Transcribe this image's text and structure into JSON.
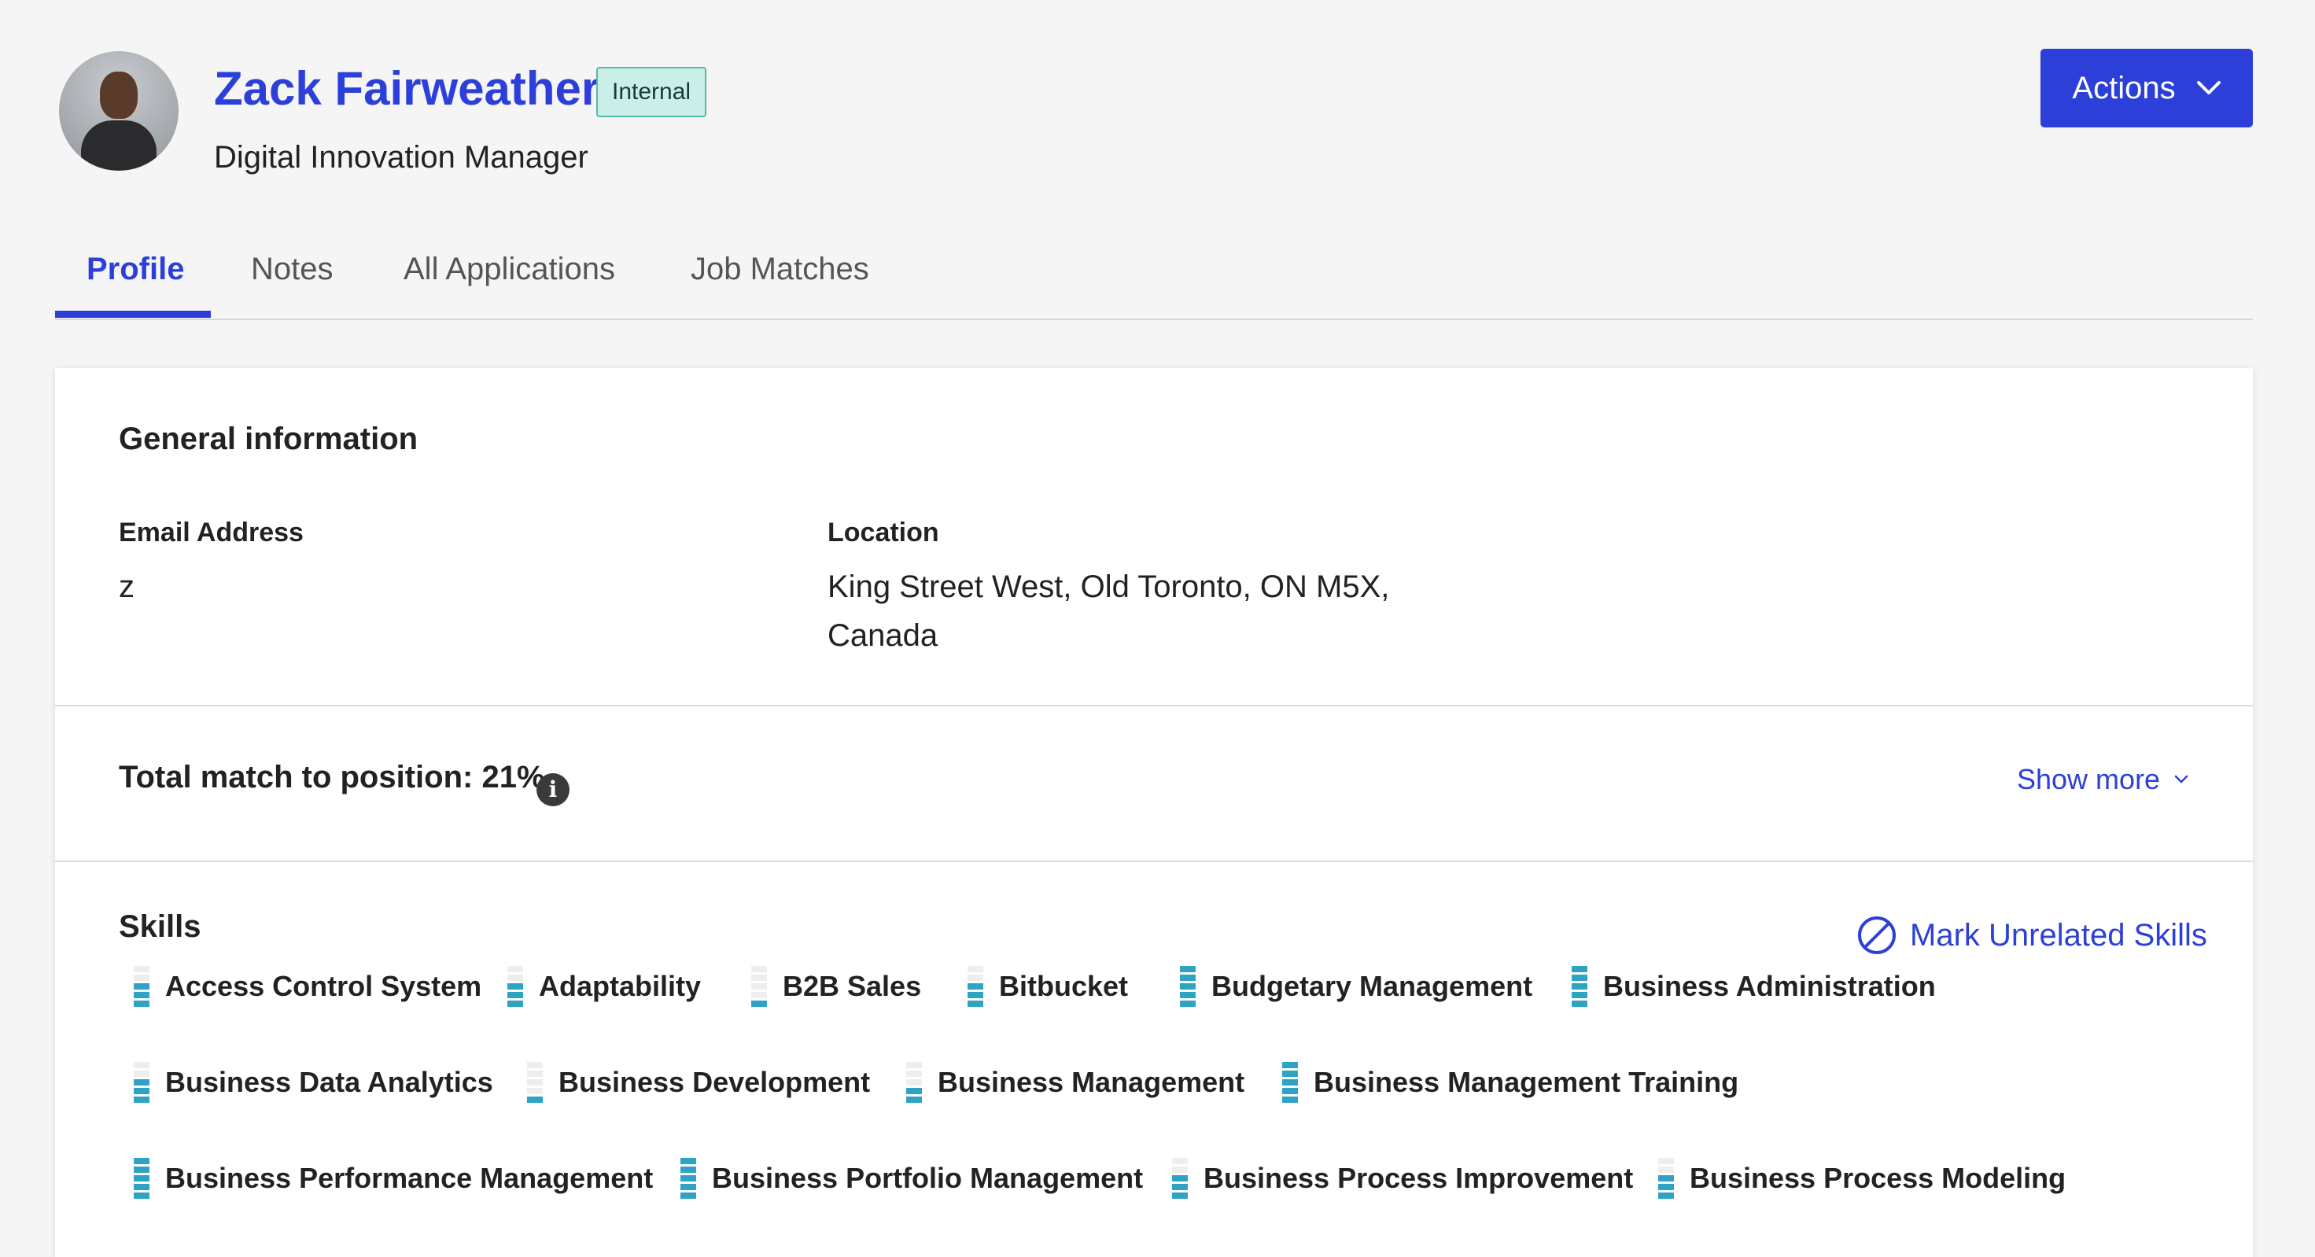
{
  "header": {
    "name": "Zack Fairweather",
    "badge": "Internal",
    "title": "Digital Innovation Manager",
    "actions_label": "Actions"
  },
  "tabs": [
    {
      "label": "Profile",
      "active": true
    },
    {
      "label": "Notes",
      "active": false
    },
    {
      "label": "All Applications",
      "active": false
    },
    {
      "label": "Job Matches",
      "active": false
    }
  ],
  "general": {
    "heading": "General information",
    "email_label": "Email Address",
    "email_value": "z",
    "location_label": "Location",
    "location_line1": "King Street West, Old Toronto, ON M5X,",
    "location_line2": "Canada"
  },
  "match": {
    "label": "Total match to position: 21%",
    "show_more": "Show more"
  },
  "skills": {
    "heading": "Skills",
    "mark_unrelated": "Mark Unrelated Skills",
    "level_max": 5,
    "items": [
      {
        "name": "Access Control System",
        "level": 3
      },
      {
        "name": "Adaptability",
        "level": 3
      },
      {
        "name": "B2B Sales",
        "level": 1
      },
      {
        "name": "Bitbucket",
        "level": 3
      },
      {
        "name": "Budgetary Management",
        "level": 5
      },
      {
        "name": "Business Administration",
        "level": 5
      },
      {
        "name": "Business Data Analytics",
        "level": 3
      },
      {
        "name": "Business Development",
        "level": 1
      },
      {
        "name": "Business Management",
        "level": 2
      },
      {
        "name": "Business Management Training",
        "level": 5
      },
      {
        "name": "Business Performance Management",
        "level": 5
      },
      {
        "name": "Business Portfolio Management",
        "level": 5
      },
      {
        "name": "Business Process Improvement",
        "level": 3
      },
      {
        "name": "Business Process Modeling",
        "level": 3
      }
    ]
  },
  "colors": {
    "accent": "#2c40d9",
    "badge_bg": "#c9efe8",
    "meter_on": "#2fa3c4"
  }
}
